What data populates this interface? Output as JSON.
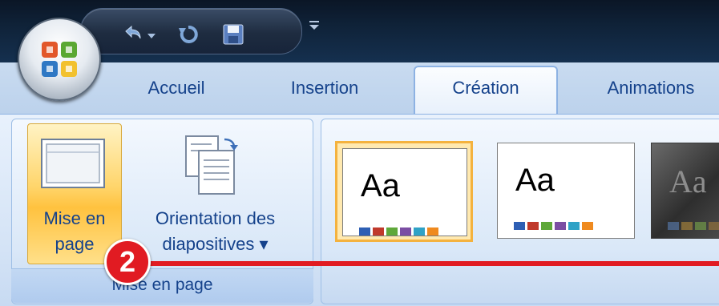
{
  "tabs": [
    "Accueil",
    "Insertion",
    "Création",
    "Animations"
  ],
  "active_tab": "Création",
  "group_mise_en_page": {
    "label": "Mise en page",
    "page_setup_button": {
      "line1": "Mise en",
      "line2": "page"
    },
    "orientation_button": {
      "line1": "Orientation des",
      "line2": "diapositives ▾"
    }
  },
  "themes": [
    {
      "sample": "Aa",
      "selected": true,
      "style": "light"
    },
    {
      "sample": "Aa",
      "selected": false,
      "style": "light"
    },
    {
      "sample": "Aa",
      "selected": false,
      "style": "dark"
    }
  ],
  "theme_swatch_colors": [
    "#2e5fb4",
    "#c0392b",
    "#5fa83a",
    "#7b4ea3",
    "#2fa2c6",
    "#ef8a1f"
  ],
  "callout": {
    "number": "2",
    "color": "#e11b22"
  },
  "qat_icons": [
    "undo-icon",
    "redo-icon",
    "save-icon"
  ],
  "colors": {
    "tab_text": "#15428b",
    "active_button": "#ffd56b"
  }
}
